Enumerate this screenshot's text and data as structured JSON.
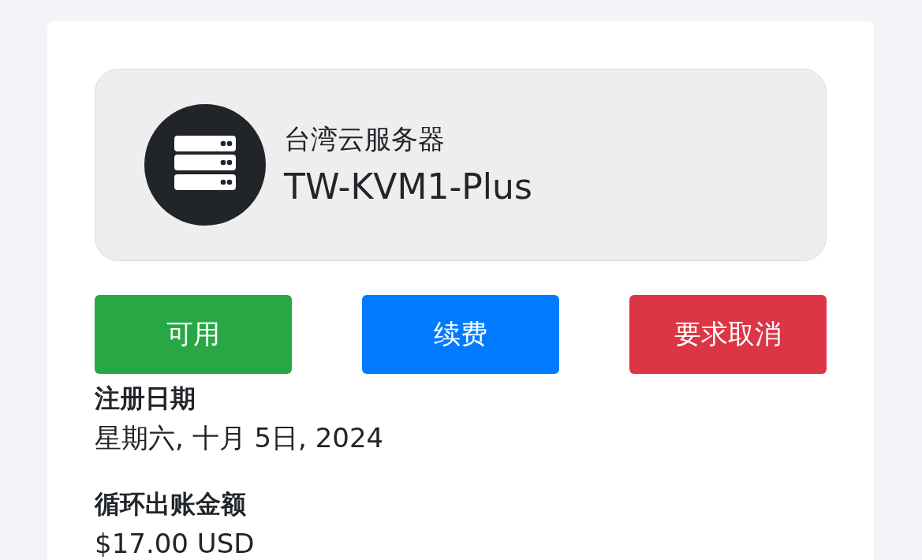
{
  "product": {
    "group": "台湾云服务器",
    "name": "TW-KVM1-Plus"
  },
  "actions": [
    {
      "label": "可用",
      "kind": "success"
    },
    {
      "label": "续费",
      "kind": "primary"
    },
    {
      "label": "要求取消",
      "kind": "danger"
    }
  ],
  "details": [
    {
      "label": "注册日期",
      "value": "星期六, 十月 5日, 2024"
    },
    {
      "label": "循环出账金额",
      "value": "$17.00 USD"
    }
  ]
}
